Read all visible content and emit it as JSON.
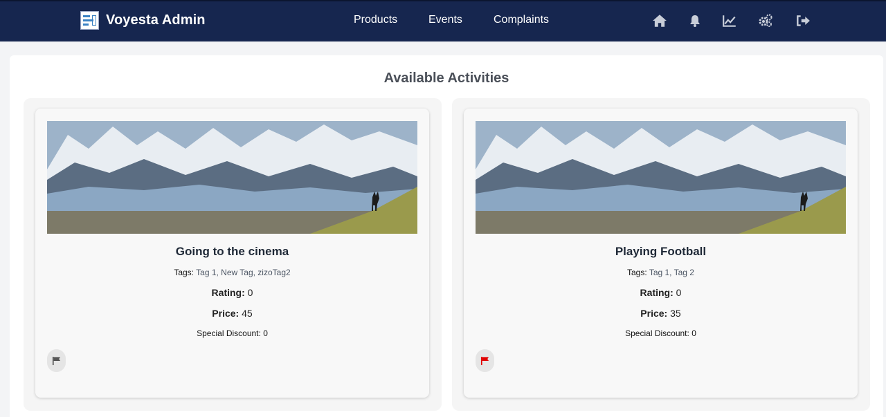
{
  "app": {
    "title": "Voyesta Admin",
    "logo_icon": "admin-logo-icon"
  },
  "nav": {
    "links": [
      "Products",
      "Events",
      "Complaints"
    ],
    "icons": [
      "home-icon",
      "bell-icon",
      "chart-line-icon",
      "gears-icon",
      "sign-out-icon"
    ]
  },
  "page": {
    "title": "Available Activities"
  },
  "labels": {
    "tags": "Tags:",
    "rating": "Rating:",
    "price": "Price:",
    "special_discount": "Special Discount:"
  },
  "activities": [
    {
      "name": "Going to the cinema",
      "tags": "Tag 1, New Tag, zizoTag2",
      "rating": "0",
      "price": "45",
      "special_discount": "0",
      "flagged": false,
      "flag_color": "#555555"
    },
    {
      "name": "Playing Football",
      "tags": "Tag 1, Tag 2",
      "rating": "0",
      "price": "35",
      "special_discount": "0",
      "flagged": true,
      "flag_color": "#e00000"
    }
  ],
  "colors": {
    "navbar": "#16264f",
    "flag_active": "#e00000",
    "flag_inactive": "#555555"
  }
}
